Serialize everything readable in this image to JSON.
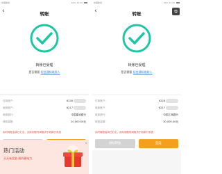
{
  "left": {
    "status": {
      "carrier": "中国移动 ",
      "right": "42% 13:20"
    },
    "nav": {
      "back": "‹",
      "title": "转账"
    },
    "result": {
      "title": "转账已受理",
      "notify_prefix": "是否需要",
      "notify_link": "短信通知收款人"
    },
    "rows": [
      {
        "label": "付款账户:",
        "value": "6228"
      },
      {
        "label": "收款账户:",
        "value": "6217"
      },
      {
        "label": "收款银行:",
        "value": "中国建设银行"
      },
      {
        "label": "转账金额:",
        "value": "20,000.00元"
      }
    ],
    "warning": "实时转账会将已汇出，实际到账时间取决于收款行系统",
    "buttons": {
      "secondary": "继续转账",
      "primary": "完成"
    },
    "promo": {
      "title": "热门活动",
      "subtitle": "天天有奖励  周四更给力",
      "close": "✕",
      "gift": "gift-box-icon"
    }
  },
  "right": {
    "status": {
      "carrier": "中国移动 ",
      "right": "42% 13:20"
    },
    "nav": {
      "back": "‹",
      "title": "转账",
      "more_icon": "share-icon"
    },
    "result": {
      "title": "转账已受理",
      "notify_prefix": "是否需要",
      "notify_link": "短信通知收款人"
    },
    "rows": [
      {
        "label": "付款账户:",
        "value": "6228"
      },
      {
        "label": "收款账户:",
        "value": "6217"
      },
      {
        "label": "收款银行:",
        "value": "中国工商银行"
      },
      {
        "label": "转账金额:",
        "value": "30,000.00元"
      }
    ],
    "warning": "实时转账会将已汇出，实际到账时间取决于收款行系统",
    "buttons": {
      "secondary": "继续转账",
      "primary": "完成"
    }
  },
  "colors": {
    "check": "#1ec7a4",
    "accent": "#f5a01d",
    "link": "#3b7fd9",
    "warning": "#e04a3c"
  }
}
